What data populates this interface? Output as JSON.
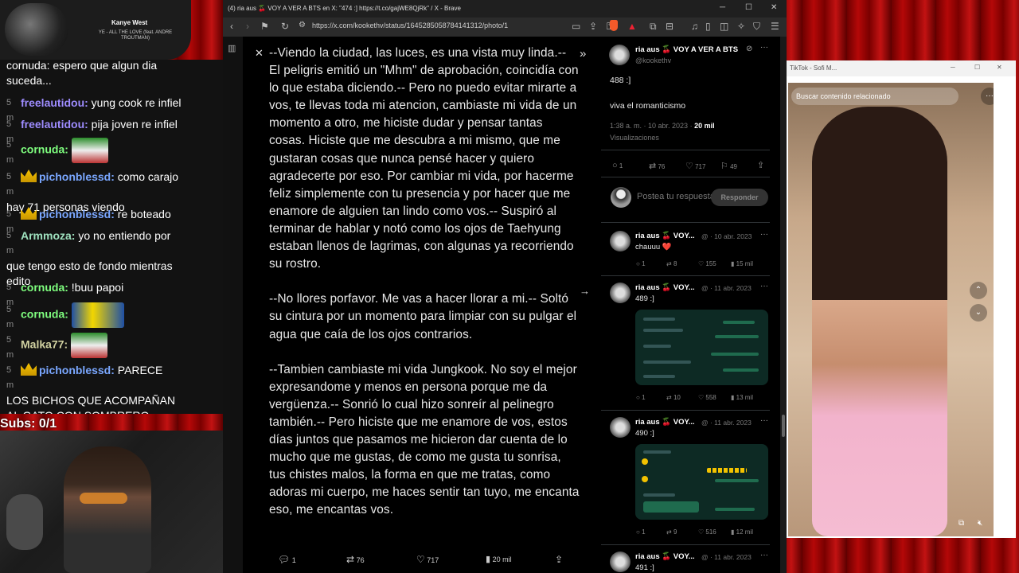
{
  "music": {
    "artist": "Kanye West",
    "song": "YE - ALL THE LOVE (feat. ANDRE TROUTMAN)"
  },
  "chat": {
    "messages": [
      {
        "ts": "",
        "user": "",
        "text": "cornuda: espero que algun dia suceda...",
        "top": 0
      },
      {
        "ts": "5 m",
        "user": "freelautidou:",
        "user_color": "#9e8cff",
        "text": "yung cook re infiel"
      },
      {
        "ts": "5 m",
        "user": "freelautidou:",
        "user_color": "#9e8cff",
        "text": "pija joven re infiel"
      },
      {
        "ts": "5 m",
        "user": "cornuda:",
        "user_color": "#7fff7f",
        "text": ""
      },
      {
        "ts": "5 m",
        "user": "pichonblessd:",
        "user_color": "#7aa7ff",
        "text": "como carajo hay 71 personas viendo"
      },
      {
        "ts": "5 m",
        "user": "pichonblessd:",
        "user_color": "#7aa7ff",
        "text": "re boteado"
      },
      {
        "ts": "5 m",
        "user": "Armmoza:",
        "user_color": "#9fe2bf",
        "text": "yo no entiendo por que tengo esto de fondo mientras edito"
      },
      {
        "ts": "5 m",
        "user": "cornuda:",
        "user_color": "#7fff7f",
        "text": "!buu papoi"
      },
      {
        "ts": "5 m",
        "user": "cornuda:",
        "user_color": "#7fff7f",
        "text": ""
      },
      {
        "ts": "5 m",
        "user": "Malka77:",
        "user_color": "#d0d0a0",
        "text": ""
      },
      {
        "ts": "5 m",
        "user": "pichonblessd:",
        "user_color": "#7aa7ff",
        "text": "PARECE LOS BICHOS QUE ACOMPAÑAN AL GATO CON SOMBRERO"
      }
    ],
    "subs": "Subs: 0/1"
  },
  "browser": {
    "title": "(4) ria aus 🍒 VOY A VER A BTS en X: \"474 :] https://t.co/gajWE8QjRk\" / X - Brave",
    "url": "https://x.com/kookethv/status/1645285058784141312/photo/1"
  },
  "lightbox": {
    "story": "--Viendo la ciudad, las luces, es una vista muy linda.-- El peligris emitió un \"Mhm\" de aprobación, coincidía con lo que estaba diciendo.-- Pero no puedo evitar mirarte a vos, te llevas toda mi atencion, cambiaste mi vida de un momento a otro, me hiciste dudar y pensar tantas cosas. Hiciste que me descubra a mi mismo, que me gustaran cosas que nunca pensé hacer y quiero agradecerte por eso. Por cambiar mi vida, por hacerme feliz simplemente con tu presencia y por hacer que me enamore de alguien tan lindo como vos.-- Suspiró al terminar de hablar y notó como los ojos de Taehyung estaban llenos de lagrimas, con algunas ya recorriendo su rostro.\n\n--No llores porfavor. Me vas a hacer llorar a mi.-- Soltó su cintura por un momento para limpiar con su pulgar el agua que caía de los ojos contrarios.\n\n--Tambien cambiaste mi vida Jungkook. No soy el mejor expresandome y menos en persona porque me da vergüenza.-- Sonrió lo cual hizo sonreír al pelinegro también.-- Pero hiciste que me enamore de vos, estos días juntos que pasamos me hicieron dar cuenta de lo mucho que me gustas, de como me gusta tu sonrisa, tus chistes malos, la forma en que me tratas, como adoras mi cuerpo, me haces sentir tan tuyo, me encanta eso, me encantas vos.",
    "replies": "1",
    "reposts": "76",
    "likes": "717",
    "views": "20 mil"
  },
  "thread": {
    "author": "ria aus 🍒 VOY A VER A BTS",
    "handle": "@kookethv",
    "text1": "488 :]",
    "text2": "viva el romanticismo",
    "time": "1:38 a. m. · 10 abr. 2023 ·",
    "views_count": "20 mil",
    "views_label": "Visualizaciones",
    "stats": {
      "replies": "1",
      "reposts": "76",
      "likes": "717",
      "bookmarks": "49"
    },
    "reply_placeholder": "Postea tu respuesta",
    "reply_button": "Responder",
    "posts": [
      {
        "name": "ria aus 🍒 VOY...",
        "date": "@ · 10 abr. 2023",
        "text": "chauuu ❤️",
        "replies": "1",
        "reposts": "8",
        "likes": "155",
        "views": "15 mil"
      },
      {
        "name": "ria aus 🍒 VOY...",
        "date": "@ · 11 abr. 2023",
        "text": "489 :]",
        "replies": "1",
        "reposts": "10",
        "likes": "558",
        "views": "13 mil"
      },
      {
        "name": "ria aus 🍒 VOY...",
        "date": "@ · 11 abr. 2023",
        "text": "490 :]",
        "replies": "1",
        "reposts": "9",
        "likes": "516",
        "views": "12 mil"
      },
      {
        "name": "ria aus 🍒 VOY...",
        "date": "@ · 11 abr. 2023",
        "text": "491 :]"
      }
    ]
  },
  "tiktok": {
    "title": "TikTok - Sofi M...",
    "search_placeholder": "Buscar contenido relacionado"
  }
}
